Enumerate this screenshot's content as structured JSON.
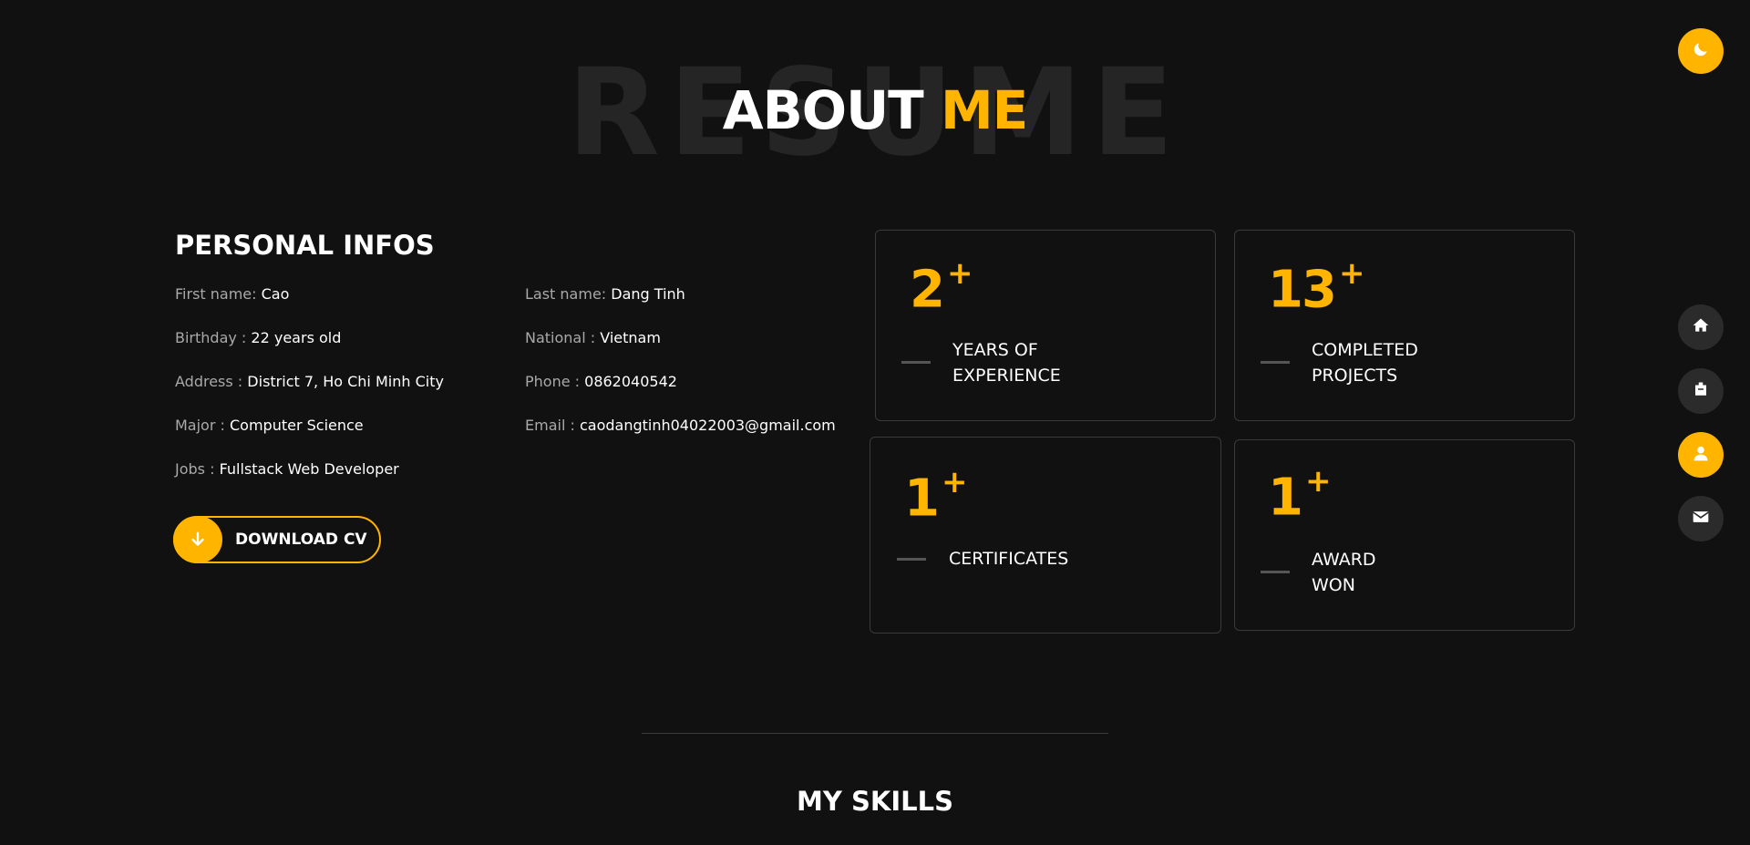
{
  "background_word": "RESUME",
  "title": {
    "main": "ABOUT",
    "accent": "ME"
  },
  "personal": {
    "heading": "PERSONAL INFOS",
    "left": [
      {
        "key": "First name:",
        "value": "Cao"
      },
      {
        "key": "Birthday :",
        "value": "22 years old"
      },
      {
        "key": "Address :",
        "value": "District 7, Ho Chi Minh City"
      },
      {
        "key": "Major :",
        "value": "Computer Science"
      },
      {
        "key": "Jobs :",
        "value": "Fullstack Web Developer"
      }
    ],
    "right": [
      {
        "key": "Last name:",
        "value": "Dang Tinh"
      },
      {
        "key": "National :",
        "value": "Vietnam"
      },
      {
        "key": "Phone :",
        "value": "0862040542"
      },
      {
        "key": "Email :",
        "value": "caodangtinh04022003@gmail.com"
      }
    ],
    "download_label": "DOWNLOAD CV"
  },
  "stats": [
    {
      "number": "2",
      "plus": "+",
      "label_line1": "YEARS OF",
      "label_line2": "EXPERIENCE"
    },
    {
      "number": "13",
      "plus": "+",
      "label_line1": "COMPLETED",
      "label_line2": "PROJECTS"
    },
    {
      "number": "1",
      "plus": "+",
      "label_line1": "CERTIFICATES",
      "label_line2": ""
    },
    {
      "number": "1",
      "plus": "+",
      "label_line1": "AWARD",
      "label_line2": "WON"
    }
  ],
  "nav": {
    "theme_icon": "moon-icon",
    "items": [
      {
        "icon": "home-icon",
        "active": false
      },
      {
        "icon": "briefcase-icon",
        "active": false
      },
      {
        "icon": "user-icon",
        "active": true
      },
      {
        "icon": "mail-icon",
        "active": false
      }
    ]
  },
  "skills_heading": "MY SKILLS",
  "colors": {
    "accent": "#ffb400",
    "background": "#111111",
    "nav_button": "#2b2b2b"
  }
}
